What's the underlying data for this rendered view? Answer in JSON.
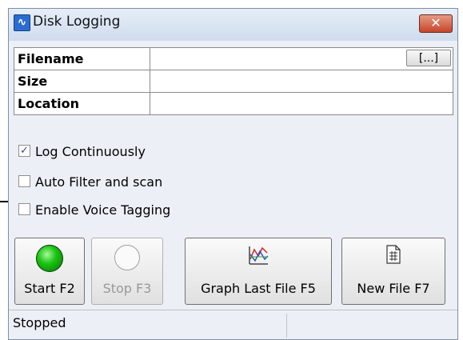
{
  "window": {
    "title": "Disk Logging",
    "close_icon": "close-x-icon",
    "app_icon": "wave-icon"
  },
  "fields": [
    {
      "label": "Filename",
      "value": ""
    },
    {
      "label": "Size",
      "value": ""
    },
    {
      "label": "Location",
      "value": ""
    }
  ],
  "browse_label": "[...]",
  "checkboxes": [
    {
      "label": "Log Continuously",
      "checked": true
    },
    {
      "label": "Auto Filter and scan",
      "checked": false
    },
    {
      "label": "Enable Voice Tagging",
      "checked": false
    }
  ],
  "buttons": {
    "start": "Start F2",
    "stop": "Stop F3",
    "graph": "Graph Last File F5",
    "new_file": "New File F7"
  },
  "status": {
    "text": "Stopped"
  },
  "colors": {
    "led_green": "#19c612",
    "close_red": "#c5452b",
    "check_blue": "#1a4fa0"
  }
}
